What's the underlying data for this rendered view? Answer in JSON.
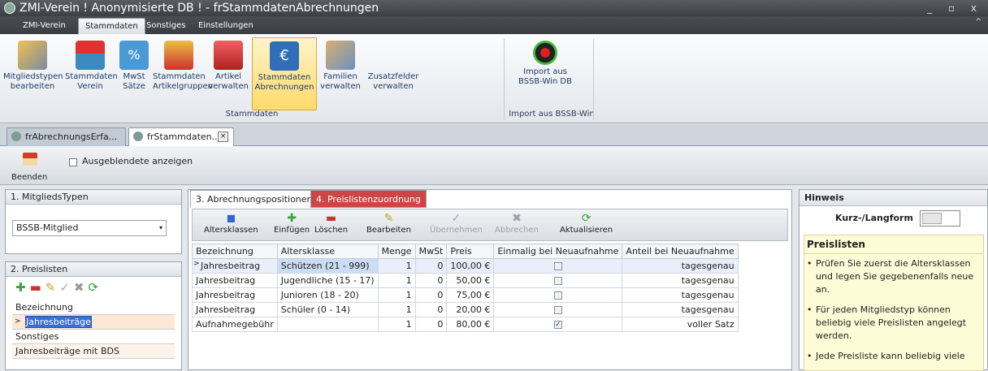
{
  "window": {
    "title": "ZMI-Verein ! Anonymisierte DB !  - frStammdatenAbrechnungen",
    "controls": "_ ▫ x"
  },
  "menu": {
    "tabs": [
      "ZMI-Verein",
      "Stammdaten",
      "Sonstiges",
      "Einstellungen"
    ],
    "active": "Stammdaten"
  },
  "ribbon": {
    "buttons": [
      {
        "l1": "Mitgliedstypen",
        "l2": "bearbeiten",
        "icon": "tools-icon"
      },
      {
        "l1": "Stammdaten",
        "l2": "Verein",
        "icon": "house-icon"
      },
      {
        "l1": "MwSt",
        "l2": "Sätze",
        "icon": "percent-icon"
      },
      {
        "l1": "Stammdaten",
        "l2": "Artikelgruppen",
        "icon": "cart-group-icon"
      },
      {
        "l1": "Artikel",
        "l2": "verwalten",
        "icon": "cart-icon"
      },
      {
        "l1": "Stammdaten",
        "l2": "Abrechnungen",
        "icon": "euro-icon"
      },
      {
        "l1": "Familien",
        "l2": "verwalten",
        "icon": "family-icon"
      },
      {
        "l1": "Zusatzfelder",
        "l2": "verwalten",
        "icon": "fields-icon"
      },
      {
        "l1": "Import aus",
        "l2": "BSSB-Win DB",
        "icon": "target-icon"
      }
    ],
    "groups": {
      "stammdaten": "Stammdaten",
      "import": "Import aus BSSB-Win"
    },
    "colors": {
      "active_bg": "#ffdb6b",
      "accent": "#cc4646"
    }
  },
  "doctabs": [
    {
      "label": "frAbrechnungsErfa..."
    },
    {
      "label": "frStammdaten...",
      "close": "×"
    }
  ],
  "toolbar": {
    "beenden": "Beenden",
    "show_hidden": "Ausgeblendete anzeigen"
  },
  "left": {
    "types_header": "1. MitgliedsTypen",
    "combo_value": "BSSB-Mitglied",
    "lists_header": "2. Preislisten",
    "col_header": "Bezeichnung",
    "rows": [
      "Jahresbeiträge",
      "Sonstiges",
      "Jahresbeiträge mit BDS"
    ]
  },
  "mid": {
    "tabs": [
      "3. Abrechnungspositionen",
      "4. Preislistenzuordnung"
    ],
    "buttons": [
      {
        "label": "Altersklassen",
        "icon": "◼"
      },
      {
        "label": "Einfügen",
        "icon": "✚"
      },
      {
        "label": "Löschen",
        "icon": "▬"
      },
      {
        "label": "Bearbeiten",
        "icon": "✎"
      },
      {
        "label": "Übernehmen",
        "icon": "✓"
      },
      {
        "label": "Abbrechen",
        "icon": "✖"
      },
      {
        "label": "Aktualisieren",
        "icon": "⟳"
      }
    ],
    "columns": [
      "Bezeichnung",
      "Altersklasse",
      "Menge",
      "MwSt",
      "Preis",
      "Einmalig bei Neuaufnahme",
      "Anteil bei Neuaufnahme"
    ],
    "rows": [
      {
        "bez": "Jahresbeitrag",
        "alter": "Schützen (21 - 999)",
        "menge": "1",
        "mwst": "0",
        "preis": "100,00 €",
        "einmalig": false,
        "anteil": "tagesgenau"
      },
      {
        "bez": "Jahresbeitrag",
        "alter": "Jugendliche (15 - 17)",
        "menge": "1",
        "mwst": "0",
        "preis": "50,00 €",
        "einmalig": false,
        "anteil": "tagesgenau"
      },
      {
        "bez": "Jahresbeitrag",
        "alter": "Junioren (18 - 20)",
        "menge": "1",
        "mwst": "0",
        "preis": "75,00 €",
        "einmalig": false,
        "anteil": "tagesgenau"
      },
      {
        "bez": "Jahresbeitrag",
        "alter": "Schüler (0 - 14)",
        "menge": "1",
        "mwst": "0",
        "preis": "20,00 €",
        "einmalig": false,
        "anteil": "tagesgenau"
      },
      {
        "bez": "Aufnahmegebühr",
        "alter": "",
        "menge": "1",
        "mwst": "0",
        "preis": "80,00 €",
        "einmalig": true,
        "anteil": "voller Satz"
      }
    ]
  },
  "right": {
    "header": "Hinweis",
    "toggle_label": "Kurz-/Langform",
    "help_title": "Preislisten",
    "bullets": [
      "Prüfen Sie zuerst die Altersklassen und legen Sie gegebenenfalls neue an.",
      "Für jeden Mitgliedstyp können beliebig viele Preislisten angelegt werden.",
      "Jede Preisliste kann beliebig viele"
    ]
  }
}
